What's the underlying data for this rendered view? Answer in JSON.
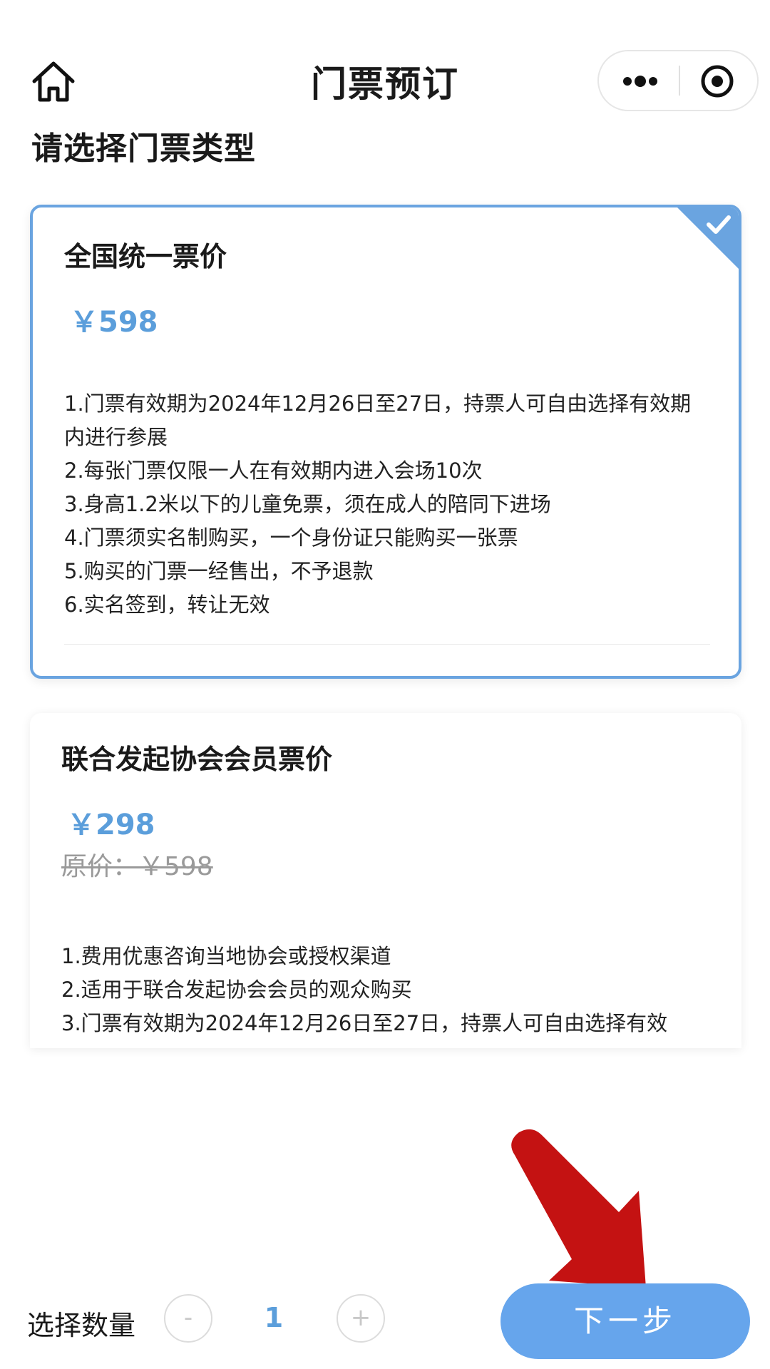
{
  "header": {
    "title": "门票预订"
  },
  "section_title": "请选择门票类型",
  "tickets": [
    {
      "name": "全国统一票价",
      "price": "￥598",
      "selected": true,
      "rules": [
        "1.门票有效期为2024年12月26日至27日，持票人可自由选择有效期内进行参展",
        "2.每张门票仅限一人在有效期内进入会场10次",
        "3.身高1.2米以下的儿童免票，须在成人的陪同下进场",
        "4.门票须实名制购买，一个身份证只能购买一张票",
        "5.购买的门票一经售出，不予退款",
        "6.实名签到，转让无效"
      ]
    },
    {
      "name": "联合发起协会会员票价",
      "price": "￥298",
      "original_price": "原价：￥598",
      "selected": false,
      "rules": [
        "1.费用优惠咨询当地协会或授权渠道",
        "2.适用于联合发起协会会员的观众购买",
        "3.门票有效期为2024年12月26日至27日，持票人可自由选择有效"
      ]
    }
  ],
  "quantity": {
    "label": "选择数量",
    "minus_label": "-",
    "value": "1",
    "plus_label": "+"
  },
  "next_button": "下一步",
  "colors": {
    "accent": "#5b9edb",
    "selected_border": "#6aa4e0",
    "button": "#66a5ec",
    "arrow": "#c41212"
  }
}
